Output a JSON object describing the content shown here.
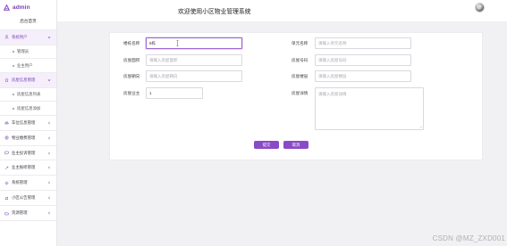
{
  "app": {
    "brand": "admin",
    "title": "欢迎使用小区物业管理系统",
    "accent_color": "#8a4ac6"
  },
  "sidebar": {
    "home": "后台首页",
    "items": [
      {
        "label": "系统用户",
        "icon": "user-icon",
        "active": true,
        "expandable": true,
        "expanded": true
      },
      {
        "label": "管理员",
        "icon": "dot-icon",
        "sub": true
      },
      {
        "label": "业主用户",
        "icon": "dot-icon",
        "sub": true
      },
      {
        "label": "房屋信息管理",
        "icon": "house-icon",
        "active": true,
        "expandable": true,
        "expanded": true
      },
      {
        "label": "房屋信息列表",
        "icon": "dot-icon",
        "sub": true
      },
      {
        "label": "房屋信息添加",
        "icon": "dot-icon",
        "sub": true
      },
      {
        "label": "车位信息管理",
        "icon": "car-icon",
        "expandable": true
      },
      {
        "label": "物业缴费管理",
        "icon": "money-icon",
        "expandable": true
      },
      {
        "label": "业主投诉管理",
        "icon": "message-icon",
        "expandable": true
      },
      {
        "label": "业主报修管理",
        "icon": "tool-icon",
        "expandable": true
      },
      {
        "label": "系统管理",
        "icon": "gear-icon",
        "expandable": true
      },
      {
        "label": "小区公告管理",
        "icon": "notice-icon",
        "expandable": true
      },
      {
        "label": "资源管理",
        "icon": "folder-icon",
        "expandable": true
      }
    ]
  },
  "form": {
    "fields": [
      {
        "label": "楼栋名称",
        "value": "8栋",
        "placeholder": "",
        "focused": true
      },
      {
        "label": "单元名称",
        "value": "",
        "placeholder": "请输入单元名称"
      },
      {
        "label": "房屋面积",
        "value": "",
        "placeholder": "请输入房屋面积"
      },
      {
        "label": "房屋号码",
        "value": "",
        "placeholder": "请输入房屋号码"
      },
      {
        "label": "房屋朝向",
        "value": "",
        "placeholder": "请输入房屋朝向"
      },
      {
        "label": "房屋楼层",
        "value": "",
        "placeholder": "请输入房屋楼层"
      },
      {
        "label": "房屋业主",
        "value": "1",
        "placeholder": ""
      },
      {
        "label": "房屋详情",
        "value": "",
        "placeholder": "请输入房屋详情"
      }
    ],
    "buttons": {
      "submit": "提交",
      "reset": "取消"
    }
  },
  "watermark": "CSDN @MZ_ZXD001"
}
